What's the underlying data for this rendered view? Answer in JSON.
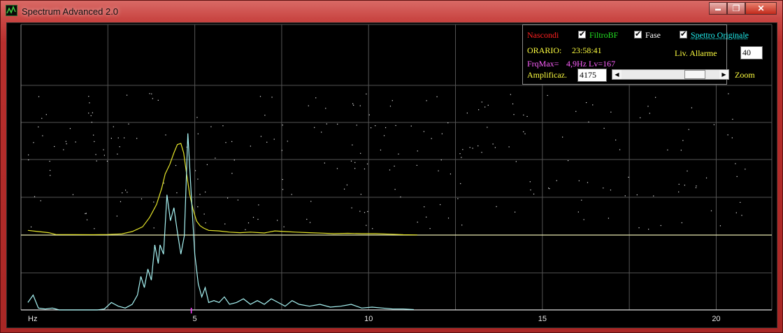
{
  "window": {
    "title": "Spectrum Advanced 2.0",
    "min": "▬",
    "max": "❐",
    "close": "✕"
  },
  "controls": {
    "nascondi": "Nascondi",
    "filtro_bf": "FiltroBF",
    "fase": "Fase",
    "spettro_originale": "Spettro Originale",
    "orario_label": "ORARIO:",
    "orario_value": "23:58:41",
    "liv_allarme_label": "Liv. Allarme",
    "liv_allarme_value": "40",
    "frqmax_label": "FrqMax=",
    "frqmax_value": "4,9Hz Lv=167",
    "amplificaz_label": "Amplificaz.",
    "amplificaz_value": "4175",
    "zoom_label": "Zoom",
    "zoom_position": 0.82,
    "checked": {
      "filtro_bf": true,
      "fase": true,
      "spettro_originale": true
    }
  },
  "colors": {
    "nascondi": "#ff2020",
    "filtro_bf": "#22e022",
    "spettro_originale": "#20f0f0",
    "yellow": "#ffff40",
    "magenta": "#ff60ff",
    "grid": "#555555",
    "fase_trace": "#e6e62a",
    "spectrum_trace": "#a8f4f4"
  },
  "chart_data": {
    "type": "line",
    "xlabel": "Hz",
    "xlim": [
      0,
      21.6
    ],
    "x_ticks": [
      5,
      10,
      15,
      20
    ],
    "marker_freq": 4.9,
    "series": [
      {
        "key": "filtro_bf",
        "ylim": [
          0,
          100
        ],
        "x": [
          0.2,
          0.5,
          0.8,
          1.0,
          2.1,
          2.5,
          2.9,
          3.2,
          3.5,
          3.7,
          3.9,
          4.05,
          4.15,
          4.28,
          4.4,
          4.5,
          4.6,
          4.68,
          4.75,
          4.85,
          4.95,
          5.05,
          5.15,
          5.25,
          5.4,
          5.7,
          6.0,
          6.3,
          6.6,
          7.0,
          7.3,
          7.6,
          7.9,
          8.3,
          8.7,
          9.0,
          9.4,
          9.8,
          10.2,
          10.6,
          11.0,
          11.4
        ],
        "y": [
          4,
          3,
          2,
          0.5,
          0.3,
          0.5,
          1,
          3,
          7,
          15,
          26,
          40,
          52,
          60,
          70,
          77,
          78,
          70,
          55,
          35,
          22,
          12,
          8,
          6,
          4,
          3.5,
          2.5,
          2,
          2.5,
          1.8,
          3.5,
          3,
          2.5,
          2,
          1.6,
          1.2,
          1.5,
          1.2,
          1.2,
          0.8,
          0.3,
          0.1
        ]
      },
      {
        "key": "spettro_originale",
        "ylim": [
          0,
          100
        ],
        "x": [
          0.2,
          0.35,
          0.5,
          0.7,
          0.9,
          1.1,
          1.3,
          2.2,
          2.4,
          2.6,
          2.8,
          3.0,
          3.2,
          3.35,
          3.45,
          3.55,
          3.65,
          3.75,
          3.85,
          3.95,
          4.0,
          4.1,
          4.2,
          4.3,
          4.4,
          4.5,
          4.6,
          4.7,
          4.8,
          4.9,
          5.0,
          5.1,
          5.2,
          5.3,
          5.4,
          5.55,
          5.7,
          5.85,
          6.0,
          6.2,
          6.4,
          6.6,
          6.8,
          7.0,
          7.2,
          7.4,
          7.6,
          7.8,
          8.0,
          8.3,
          8.6,
          8.9,
          9.2,
          9.5,
          9.8,
          10.1,
          10.4,
          10.7,
          11.0,
          11.3
        ],
        "y": [
          4,
          8,
          1,
          0.5,
          1,
          0,
          0,
          0,
          0.5,
          4,
          2,
          1,
          3,
          8,
          18,
          12,
          22,
          16,
          35,
          25,
          35,
          30,
          62,
          48,
          55,
          42,
          30,
          40,
          95,
          62,
          30,
          14,
          7,
          12,
          4,
          5,
          4,
          7,
          3,
          4,
          6,
          3,
          5,
          3,
          6,
          4,
          2,
          5,
          3,
          2,
          3,
          1.5,
          2,
          3,
          1,
          1.5,
          1,
          0.5,
          0.5,
          0.2
        ]
      }
    ]
  }
}
